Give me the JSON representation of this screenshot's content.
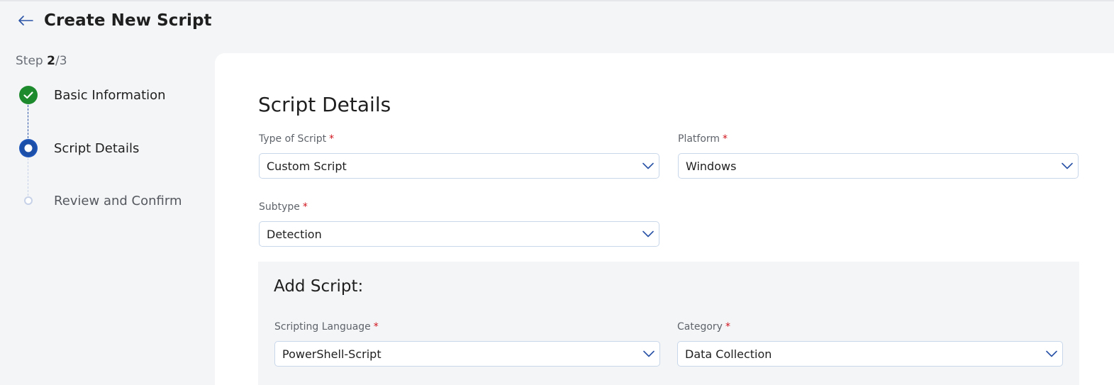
{
  "header": {
    "title": "Create New Script",
    "back_icon": "arrow-left-icon"
  },
  "stepper": {
    "prefix": "Step ",
    "current": "2",
    "total": "/3",
    "steps": [
      {
        "label": "Basic Information",
        "state": "completed"
      },
      {
        "label": "Script Details",
        "state": "active"
      },
      {
        "label": "Review and Confirm",
        "state": "pending"
      }
    ]
  },
  "form": {
    "section_title": "Script Details",
    "type_of_script": {
      "label": "Type of Script",
      "required": "*",
      "value": "Custom Script"
    },
    "platform": {
      "label": "Platform",
      "required": "*",
      "value": "Windows"
    },
    "subtype": {
      "label": "Subtype",
      "required": "*",
      "value": "Detection"
    },
    "add_script": {
      "title": "Add Script:",
      "scripting_language": {
        "label": "Scripting Language",
        "required": "*",
        "value": "PowerShell-Script"
      },
      "category": {
        "label": "Category",
        "required": "*",
        "value": "Data Collection"
      }
    }
  },
  "colors": {
    "accent": "#2a53a6",
    "success": "#1e8a2e",
    "required": "#d0121b"
  }
}
